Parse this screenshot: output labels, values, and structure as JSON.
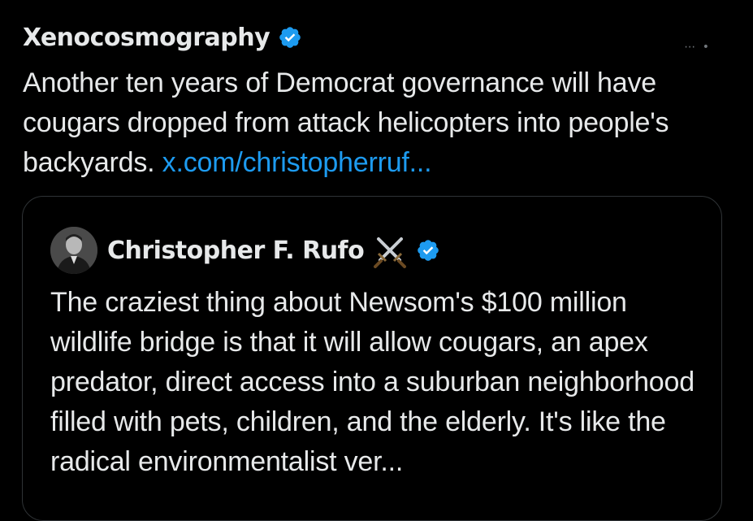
{
  "tweet": {
    "author_name": "Xenocosmography",
    "verified_icon": "verified-badge-icon",
    "text": "Another ten years of Democrat governance will have cougars dropped from attack helicopters into people's backyards. ",
    "link_text": "x.com/christopherruf..."
  },
  "quote": {
    "author_name": "Christopher F. Rufo",
    "emoji_icon": "crossed-swords-icon",
    "verified_icon": "verified-badge-icon",
    "text": "The craziest thing about Newsom's $100 million wildlife bridge is that it will allow cougars, an apex predator, direct access into a suburban neighborhood filled with pets, children, and the elderly. It's like the radical environmentalist ver..."
  },
  "colors": {
    "background": "#000000",
    "text": "#e7e9ea",
    "link": "#1d9bf0",
    "verified": "#1d9bf0",
    "border": "#2f3336"
  }
}
